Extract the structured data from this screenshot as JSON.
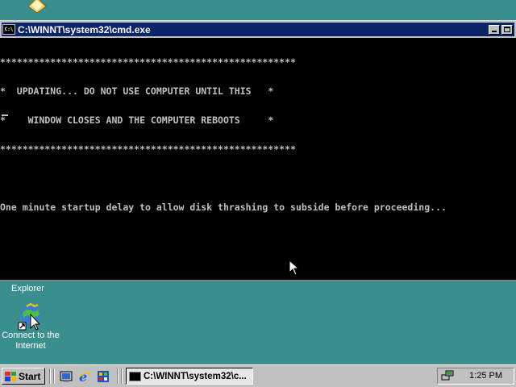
{
  "desktop": {
    "explorer_label": "Explorer",
    "connect_icon_label": "Connect to the Internet",
    "background_color": "#3a8f8e"
  },
  "window": {
    "title": "C:\\WINNT\\system32\\cmd.exe",
    "title_bar_color": "#0a246a"
  },
  "console": {
    "lines": [
      "*****************************************************",
      "*  UPDATING... DO NOT USE COMPUTER UNTIL THIS   *",
      "*    WINDOW CLOSES AND THE COMPUTER REBOOTS     *",
      "*****************************************************",
      "",
      "One minute startup delay to allow disk thrashing to subside before proceeding..."
    ]
  },
  "taskbar": {
    "start_label": "Start",
    "task_button_label": "C:\\WINNT\\system32\\c...",
    "clock": "1:25 PM",
    "quick_launch_icons": [
      "show-desktop-icon",
      "internet-explorer-icon",
      "channels-icon"
    ]
  }
}
